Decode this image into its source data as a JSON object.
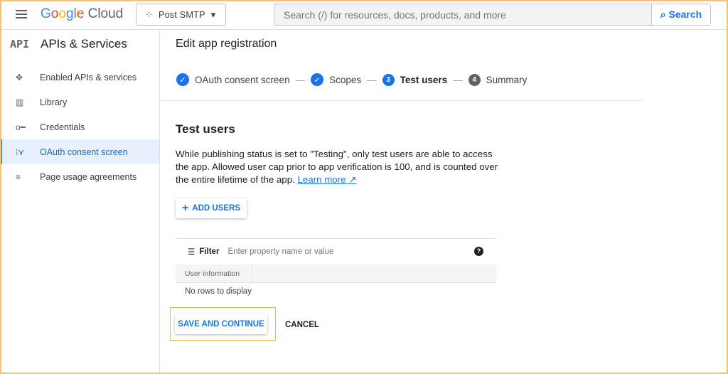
{
  "header": {
    "logo": "Google Cloud",
    "project": "Post SMTP",
    "search_placeholder": "Search (/) for resources, docs, products, and more",
    "search_button": "Search"
  },
  "sidebar": {
    "badge": "API",
    "title": "APIs & Services",
    "items": [
      {
        "label": "Enabled APIs & services",
        "icon": "hub-icon"
      },
      {
        "label": "Library",
        "icon": "library-icon"
      },
      {
        "label": "Credentials",
        "icon": "key-icon"
      },
      {
        "label": "OAuth consent screen",
        "icon": "consent-icon",
        "active": true
      },
      {
        "label": "Page usage agreements",
        "icon": "settings-list-icon"
      }
    ]
  },
  "main": {
    "title": "Edit app registration",
    "steps": [
      {
        "label": "OAuth consent screen",
        "state": "done"
      },
      {
        "label": "Scopes",
        "state": "done"
      },
      {
        "num": "3",
        "label": "Test users",
        "state": "current"
      },
      {
        "num": "4",
        "label": "Summary",
        "state": "pending"
      }
    ],
    "section_title": "Test users",
    "description": "While publishing status is set to \"Testing\", only test users are able to access the app. Allowed user cap prior to app verification is 100, and is counted over the entire lifetime of the app.",
    "learn_more": "Learn more",
    "add_users": "ADD USERS",
    "filter_label": "Filter",
    "filter_placeholder": "Enter property name or value",
    "column": "User information",
    "empty": "No rows to display",
    "save": "SAVE AND CONTINUE",
    "cancel": "CANCEL"
  },
  "colors": {
    "accent": "#1a73e8",
    "highlight": "#f2b14b"
  }
}
